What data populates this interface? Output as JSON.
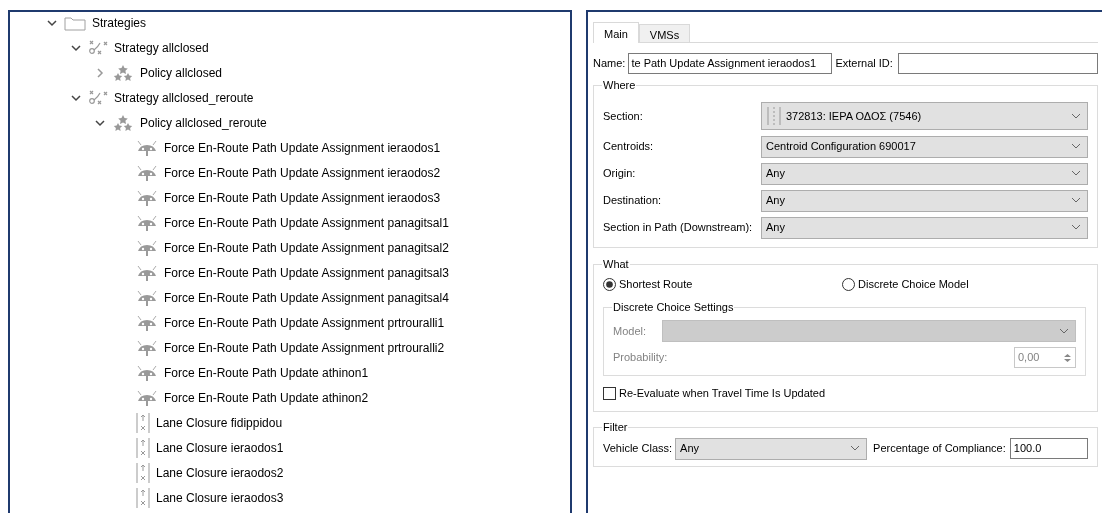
{
  "tree": {
    "nodes": [
      {
        "kind": "folder",
        "label": "Strategies",
        "expanded": true,
        "children": [
          {
            "kind": "strategy",
            "label": "Strategy allclosed",
            "expanded": true,
            "children": [
              {
                "kind": "policy",
                "label": "Policy allclosed",
                "expanded": false
              }
            ]
          },
          {
            "kind": "strategy",
            "label": "Strategy allclosed_reroute",
            "expanded": true,
            "children": [
              {
                "kind": "policy",
                "label": "Policy allclosed_reroute",
                "expanded": true,
                "children": [
                  {
                    "kind": "force",
                    "label": "Force En-Route Path Update Assignment ieraodos1"
                  },
                  {
                    "kind": "force",
                    "label": "Force En-Route Path Update Assignment ieraodos2"
                  },
                  {
                    "kind": "force",
                    "label": "Force En-Route Path Update Assignment ieraodos3"
                  },
                  {
                    "kind": "force",
                    "label": "Force En-Route Path Update Assignment panagitsal1"
                  },
                  {
                    "kind": "force",
                    "label": "Force En-Route Path Update Assignment panagitsal2"
                  },
                  {
                    "kind": "force",
                    "label": "Force En-Route Path Update Assignment panagitsal3"
                  },
                  {
                    "kind": "force",
                    "label": "Force En-Route Path Update Assignment panagitsal4"
                  },
                  {
                    "kind": "force",
                    "label": "Force En-Route Path Update Assignment prtrouralli1"
                  },
                  {
                    "kind": "force",
                    "label": "Force En-Route Path Update Assignment prtrouralli2"
                  },
                  {
                    "kind": "force",
                    "label": "Force En-Route Path Update athinon1"
                  },
                  {
                    "kind": "force",
                    "label": "Force En-Route Path Update athinon2"
                  },
                  {
                    "kind": "lane",
                    "label": "Lane Closure fidippidou"
                  },
                  {
                    "kind": "lane",
                    "label": "Lane Closure ieraodos1"
                  },
                  {
                    "kind": "lane",
                    "label": "Lane Closure ieraodos2"
                  },
                  {
                    "kind": "lane",
                    "label": "Lane Closure ieraodos3"
                  }
                ]
              }
            ]
          }
        ]
      }
    ]
  },
  "tabs": [
    {
      "label": "Main",
      "selected": true
    },
    {
      "label": "VMSs",
      "selected": false
    }
  ],
  "name_field": {
    "label": "Name:",
    "value": "te Path Update Assignment ieraodos1"
  },
  "external_id_field": {
    "label": "External ID:"
  },
  "where": {
    "title": "Where",
    "rows": [
      {
        "kind": "section",
        "label": "Section:",
        "value": "372813: ΙΕΡΑ ΟΔΟΣ (7546)"
      },
      {
        "kind": "plain",
        "label": "Centroids:",
        "value": "Centroid Configuration 690017"
      },
      {
        "kind": "plain",
        "label": "Origin:",
        "value": "Any"
      },
      {
        "kind": "plain",
        "label": "Destination:",
        "value": "Any"
      },
      {
        "kind": "plain",
        "label": "Section in Path (Downstream):",
        "value": "Any"
      }
    ]
  },
  "what": {
    "title": "What",
    "options": [
      {
        "label": "Shortest Route",
        "selected": true
      },
      {
        "label": "Discrete Choice Model",
        "selected": false
      }
    ],
    "settings": {
      "title": "Discrete Choice Settings",
      "disabled": true,
      "model_label": "Model:",
      "probability_label": "Probability:",
      "probability_value": "0,00"
    },
    "checkbox": {
      "label": "Re-Evaluate when Travel Time Is Updated",
      "checked": false
    }
  },
  "filter": {
    "title": "Filter",
    "vehicle_class_label": "Vehicle Class:",
    "vehicle_class_value": "Any",
    "compliance_label": "Percentage of Compliance:",
    "compliance_value": "100.0"
  }
}
